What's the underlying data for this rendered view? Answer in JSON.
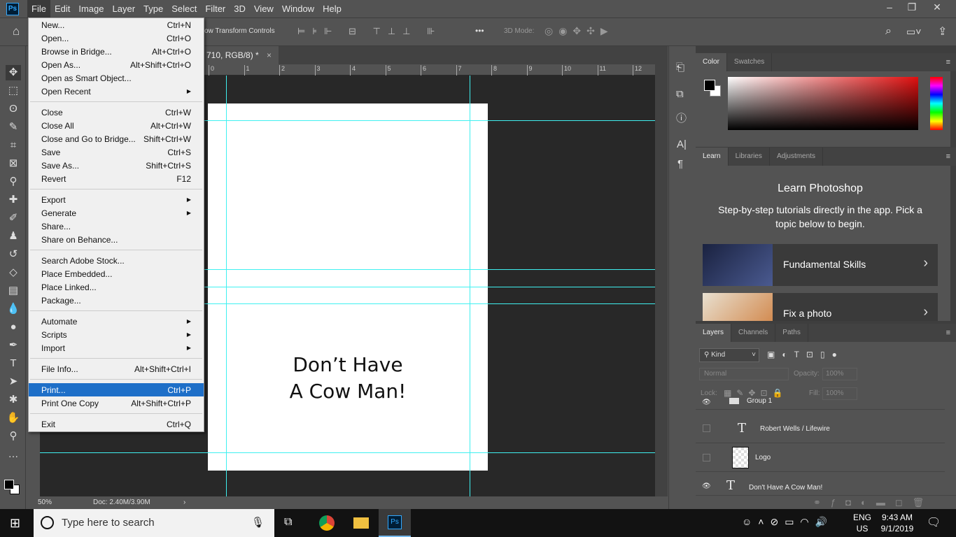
{
  "app": {
    "logo": "Ps"
  },
  "menubar": [
    "File",
    "Edit",
    "Image",
    "Layer",
    "Type",
    "Select",
    "Filter",
    "3D",
    "View",
    "Window",
    "Help"
  ],
  "window_controls": {
    "minimize": "–",
    "restore": "❐",
    "close": "✕"
  },
  "options_bar": {
    "transform_label": "ow Transform Controls",
    "mode_label": "3D Mode:",
    "more": "•••"
  },
  "document_tab": {
    "title": "710, RGB/8) *",
    "close": "×"
  },
  "ruler_top": [
    "0",
    "1",
    "2",
    "3",
    "4",
    "5",
    "6",
    "7",
    "8",
    "9",
    "10",
    "11",
    "12"
  ],
  "canvas": {
    "line1": "Don’t Have",
    "line2": "A Cow Man!"
  },
  "status": {
    "zoom": "50%",
    "doc": "Doc: 2.40M/3.90M",
    "arrow": "›"
  },
  "file_menu": {
    "groups": [
      [
        {
          "label": "New...",
          "shortcut": "Ctrl+N"
        },
        {
          "label": "Open...",
          "shortcut": "Ctrl+O"
        },
        {
          "label": "Browse in Bridge...",
          "shortcut": "Alt+Ctrl+O"
        },
        {
          "label": "Open As...",
          "shortcut": "Alt+Shift+Ctrl+O"
        },
        {
          "label": "Open as Smart Object...",
          "shortcut": ""
        },
        {
          "label": "Open Recent",
          "shortcut": "",
          "submenu": true
        }
      ],
      [
        {
          "label": "Close",
          "shortcut": "Ctrl+W"
        },
        {
          "label": "Close All",
          "shortcut": "Alt+Ctrl+W"
        },
        {
          "label": "Close and Go to Bridge...",
          "shortcut": "Shift+Ctrl+W"
        },
        {
          "label": "Save",
          "shortcut": "Ctrl+S"
        },
        {
          "label": "Save As...",
          "shortcut": "Shift+Ctrl+S"
        },
        {
          "label": "Revert",
          "shortcut": "F12"
        }
      ],
      [
        {
          "label": "Export",
          "shortcut": "",
          "submenu": true
        },
        {
          "label": "Generate",
          "shortcut": "",
          "submenu": true
        },
        {
          "label": "Share...",
          "shortcut": ""
        },
        {
          "label": "Share on Behance...",
          "shortcut": ""
        }
      ],
      [
        {
          "label": "Search Adobe Stock...",
          "shortcut": ""
        },
        {
          "label": "Place Embedded...",
          "shortcut": ""
        },
        {
          "label": "Place Linked...",
          "shortcut": ""
        },
        {
          "label": "Package...",
          "shortcut": ""
        }
      ],
      [
        {
          "label": "Automate",
          "shortcut": "",
          "submenu": true
        },
        {
          "label": "Scripts",
          "shortcut": "",
          "submenu": true
        },
        {
          "label": "Import",
          "shortcut": "",
          "submenu": true
        }
      ],
      [
        {
          "label": "File Info...",
          "shortcut": "Alt+Shift+Ctrl+I"
        }
      ],
      [
        {
          "label": "Print...",
          "shortcut": "Ctrl+P",
          "highlighted": true
        },
        {
          "label": "Print One Copy",
          "shortcut": "Alt+Shift+Ctrl+P"
        }
      ],
      [
        {
          "label": "Exit",
          "shortcut": "Ctrl+Q"
        }
      ]
    ]
  },
  "color_panel": {
    "tabs": [
      "Color",
      "Swatches"
    ],
    "hue_color": "#e01010"
  },
  "learn_panel": {
    "tabs": [
      "Learn",
      "Libraries",
      "Adjustments"
    ],
    "title": "Learn Photoshop",
    "description": "Step-by-step tutorials directly in the app. Pick a topic below to begin.",
    "cards": [
      "Fundamental Skills",
      "Fix a photo"
    ]
  },
  "layers_panel": {
    "tabs": [
      "Layers",
      "Channels",
      "Paths"
    ],
    "filter": "Kind",
    "blend_mode": "Normal",
    "opacity_label": "Opacity:",
    "opacity": "100%",
    "lock_label": "Lock:",
    "fill_label": "Fill:",
    "fill": "100%",
    "layers": [
      {
        "name": "Group 1",
        "visible": true
      },
      {
        "name": "Robert Wells / Lifewire",
        "visible": false
      },
      {
        "name": "Logo",
        "visible": false
      },
      {
        "name": "Don't Have A Cow Man!",
        "visible": true
      }
    ]
  },
  "taskbar": {
    "search_placeholder": "Type here to search",
    "lang1": "ENG",
    "lang2": "US",
    "time": "9:43 AM",
    "date": "9/1/2019"
  },
  "accent": "#1e6fc8",
  "guide_color": "#3ff0f0"
}
